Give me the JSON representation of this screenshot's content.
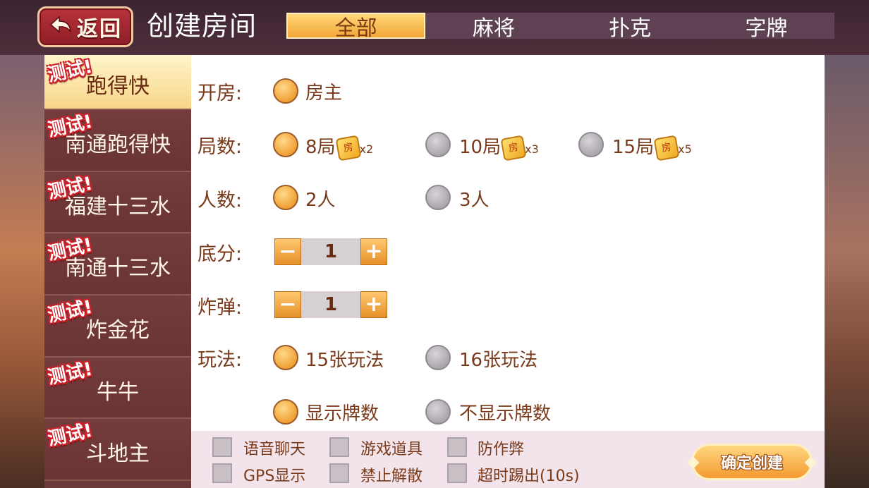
{
  "header": {
    "back_label": "返回",
    "title": "创建房间",
    "tabs": [
      {
        "label": "全部",
        "active": true
      },
      {
        "label": "麻将",
        "active": false
      },
      {
        "label": "扑克",
        "active": false
      },
      {
        "label": "字牌",
        "active": false
      }
    ]
  },
  "sidebar": {
    "badge": "测试!",
    "items": [
      {
        "label": "跑得快",
        "active": true
      },
      {
        "label": "南通跑得快",
        "active": false
      },
      {
        "label": "福建十三水",
        "active": false
      },
      {
        "label": "南通十三水",
        "active": false
      },
      {
        "label": "炸金花",
        "active": false
      },
      {
        "label": "牛牛",
        "active": false
      },
      {
        "label": "斗地主",
        "active": false
      }
    ]
  },
  "form": {
    "open_room": {
      "label": "开房:",
      "options": [
        {
          "text": "房主",
          "selected": true
        }
      ]
    },
    "rounds": {
      "label": "局数:",
      "coin_text": "房",
      "options": [
        {
          "text": "8局",
          "multiplier": "x2",
          "selected": true
        },
        {
          "text": "10局",
          "multiplier": "x3",
          "selected": false
        },
        {
          "text": "15局",
          "multiplier": "x5",
          "selected": false
        }
      ]
    },
    "players": {
      "label": "人数:",
      "options": [
        {
          "text": "2人",
          "selected": true
        },
        {
          "text": "3人",
          "selected": false
        }
      ]
    },
    "base_score": {
      "label": "底分:",
      "value": "1",
      "minus": "−",
      "plus": "+"
    },
    "bomb": {
      "label": "炸弹:",
      "value": "1",
      "minus": "−",
      "plus": "+"
    },
    "play_mode": {
      "label": "玩法:",
      "options": [
        {
          "text": "15张玩法",
          "selected": true
        },
        {
          "text": "16张玩法",
          "selected": false
        }
      ]
    },
    "card_count": {
      "options": [
        {
          "text": "显示牌数",
          "selected": true
        },
        {
          "text": "不显示牌数",
          "selected": false
        }
      ]
    }
  },
  "extras": {
    "checkboxes": [
      {
        "text": "语音聊天",
        "checked": false
      },
      {
        "text": "游戏道具",
        "checked": false
      },
      {
        "text": "防作弊",
        "checked": false
      },
      {
        "text": "GPS显示",
        "checked": false
      },
      {
        "text": "禁止解散",
        "checked": false
      },
      {
        "text": "超时踢出(10s)",
        "checked": false
      }
    ],
    "confirm_label": "确定创建"
  }
}
